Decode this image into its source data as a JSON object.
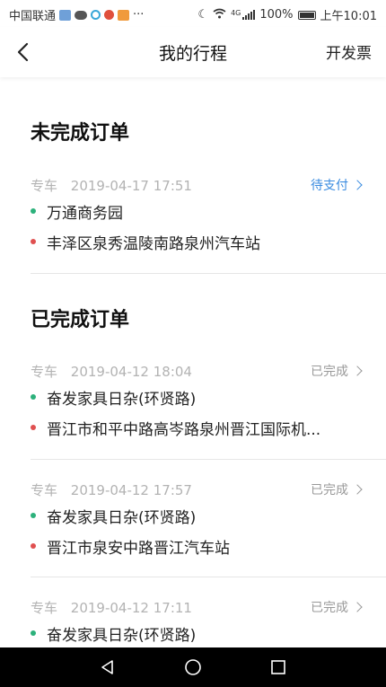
{
  "status_bar": {
    "carrier": "中国联通",
    "more": "···",
    "network": "4G",
    "battery": "100%",
    "time": "上午10:01"
  },
  "header": {
    "title": "我的行程",
    "invoice_label": "开发票"
  },
  "sections": {
    "incomplete_title": "未完成订单",
    "complete_title": "已完成订单"
  },
  "orders": [
    {
      "type": "专车",
      "time": "2019-04-17 17:51",
      "status": "待支付",
      "from": "万通商务园",
      "to": "丰泽区泉秀温陵南路泉州汽车站"
    },
    {
      "type": "专车",
      "time": "2019-04-12 18:04",
      "status": "已完成",
      "from": "奋发家具日杂(环贤路)",
      "to": "晋江市和平中路高岑路泉州晋江国际机..."
    },
    {
      "type": "专车",
      "time": "2019-04-12 17:57",
      "status": "已完成",
      "from": "奋发家具日杂(环贤路)",
      "to": "晋江市泉安中路晋江汽车站"
    },
    {
      "type": "专车",
      "time": "2019-04-12 17:11",
      "status": "已完成",
      "from": "奋发家具日杂(环贤路)",
      "to": ""
    }
  ],
  "colors": {
    "pending": "#3b8ce0",
    "start_dot": "#2cb17b",
    "end_dot": "#e05050"
  },
  "icons": [
    "back-arrow-icon",
    "chevron-right-icon",
    "nav-back-icon",
    "nav-home-icon",
    "nav-recent-icon"
  ]
}
